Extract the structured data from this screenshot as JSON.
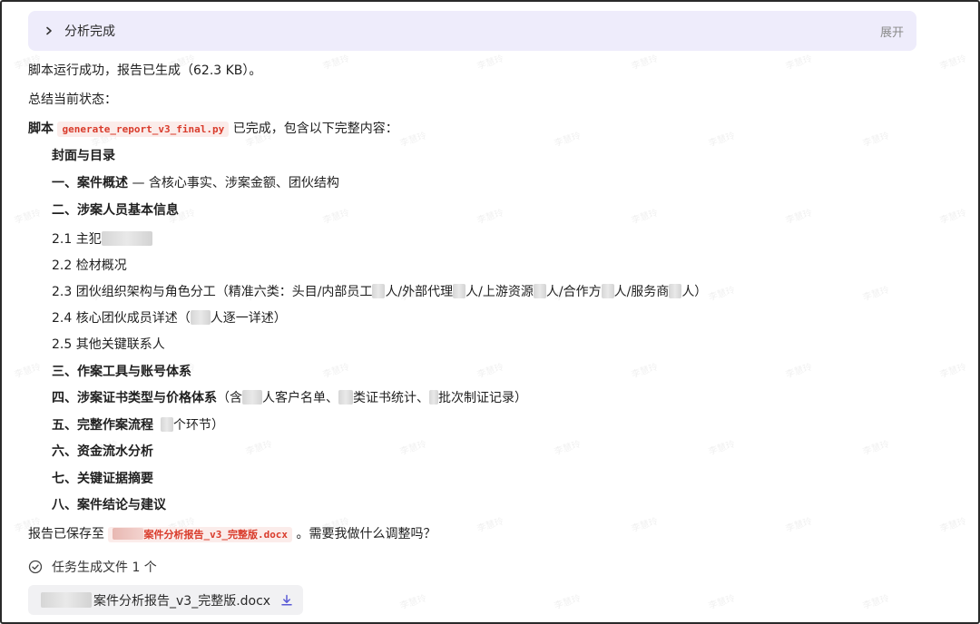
{
  "header": {
    "title": "分析完成",
    "toggle": "展开"
  },
  "status_line": "脚本运行成功，报告已生成（62.3 KB）。",
  "summary_label": "总结当前状态：",
  "script_line": {
    "prefix": "脚本",
    "filename": "generate_report_v3_final.py",
    "suffix": "已完成，包含以下完整内容："
  },
  "sections": {
    "cover": "封面与目录",
    "s1_bold": "一、案件概述",
    "s1_rest": " — 含核心事实、涉案金额、团伙结构",
    "s2": "二、涉案人员基本信息",
    "s2_1": "2.1 主犯",
    "s2_2": "2.2 检材概况",
    "s2_3_a": "2.3 团伙组织架构与角色分工（精准六类：头目/内部员工",
    "s2_3_b": "人/外部代理",
    "s2_3_c": "人/上游资源",
    "s2_3_d": "人/合作方",
    "s2_3_e": "人/服务商",
    "s2_3_f": "人）",
    "s2_4_a": "2.4 核心团伙成员详述（",
    "s2_4_b": "人逐一详述）",
    "s2_5": "2.5 其他关键联系人",
    "s3": "三、作案工具与账号体系",
    "s4_bold": "四、涉案证书类型与价格体系",
    "s4_a": "（含",
    "s4_b": "人客户名单、",
    "s4_c": "类证书统计、",
    "s4_d": "批次制证记录）",
    "s5_bold": "五、完整作案流程",
    "s5_rest": "个环节）",
    "s6": "六、资金流水分析",
    "s7": "七、关键证据摘要",
    "s8": "八、案件结论与建议"
  },
  "saved_line": {
    "prefix": "报告已保存至",
    "path": "案件分析报告_v3_完整版.docx",
    "suffix": "。需要我做什么调整吗？"
  },
  "tasks": {
    "label": "任务生成文件 1 个"
  },
  "file": {
    "name": "案件分析报告_v3_完整版.docx"
  },
  "watermark": "李慧玲",
  "colors": {
    "accent_bg": "#eeecfb",
    "code_red": "#d93b2b",
    "chip_bg": "#f1f1f3"
  },
  "icons": {
    "expand": "chevron-right-icon",
    "task": "check-circle-icon",
    "download": "download-icon"
  }
}
